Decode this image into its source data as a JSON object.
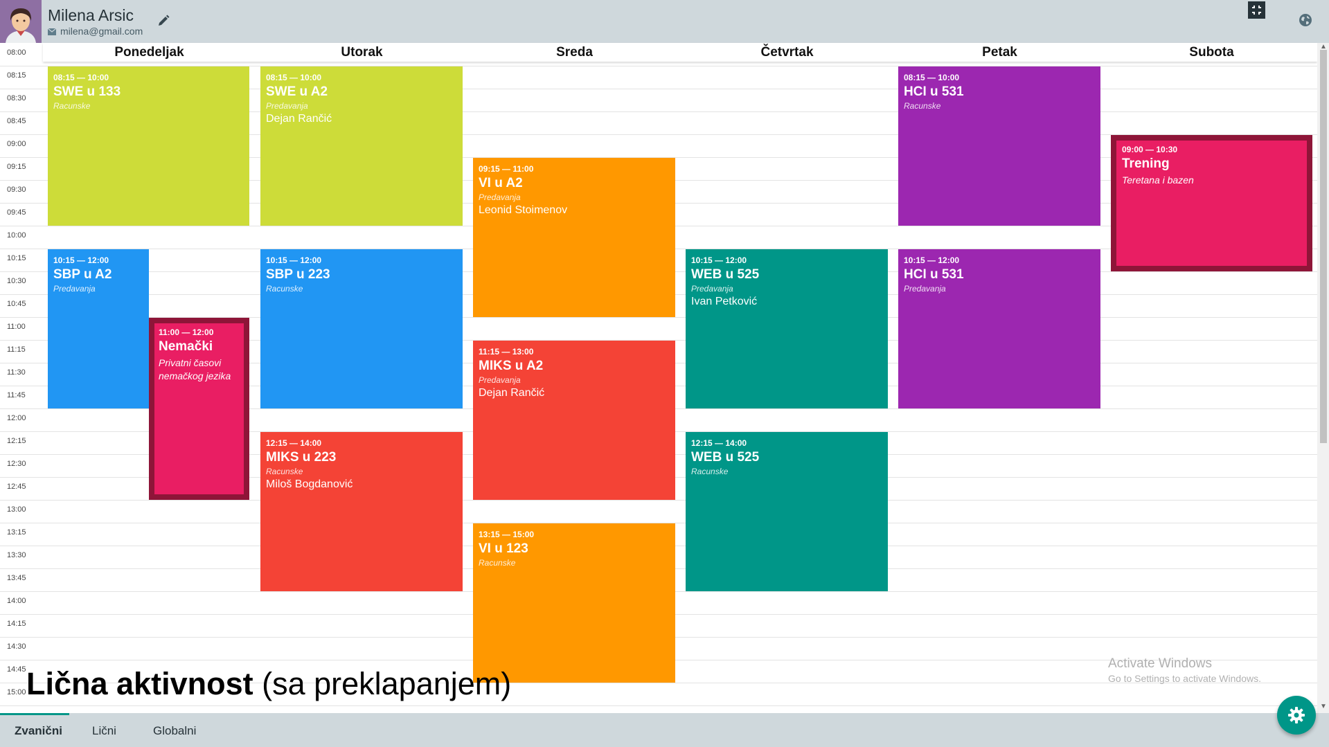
{
  "user": {
    "name": "Milena Arsic",
    "email": "milena@gmail.com"
  },
  "days": [
    "Ponedeljak",
    "Utorak",
    "Sreda",
    "Četvrtak",
    "Petak",
    "Subota"
  ],
  "times": [
    "08:00",
    "08:15",
    "08:30",
    "08:45",
    "09:00",
    "09:15",
    "09:30",
    "09:45",
    "10:00",
    "10:15",
    "10:30",
    "10:45",
    "11:00",
    "11:15",
    "11:30",
    "11:45",
    "12:00",
    "12:15",
    "12:30",
    "12:45",
    "13:00",
    "13:15",
    "13:30",
    "13:45",
    "14:00",
    "14:15",
    "14:30",
    "14:45",
    "15:00"
  ],
  "events": {
    "mon_swe": {
      "time": "08:15 — 10:00",
      "title": "SWE u 133",
      "type": "Racunske"
    },
    "mon_sbp": {
      "time": "10:15 — 12:00",
      "title": "SBP u A2",
      "type": "Predavanja"
    },
    "mon_nemacki": {
      "time": "11:00 — 12:00",
      "title": "Nemački",
      "note": "Privatni časovi nemačkog jezika"
    },
    "tue_swe": {
      "time": "08:15 — 10:00",
      "title": "SWE u A2",
      "type": "Predavanja",
      "lecturer": "Dejan Rančić"
    },
    "tue_sbp": {
      "time": "10:15 — 12:00",
      "title": "SBP u 223",
      "type": "Racunske"
    },
    "tue_miks": {
      "time": "12:15 — 14:00",
      "title": "MIKS u 223",
      "type": "Racunske",
      "lecturer": "Miloš Bogdanović"
    },
    "wed_vi": {
      "time": "09:15 — 11:00",
      "title": "VI u A2",
      "type": "Predavanja",
      "lecturer": "Leonid Stoimenov"
    },
    "wed_miks": {
      "time": "11:15 — 13:00",
      "title": "MIKS u A2",
      "type": "Predavanja",
      "lecturer": "Dejan Rančić"
    },
    "wed_vi123": {
      "time": "13:15 — 15:00",
      "title": "VI u 123",
      "type": "Racunske"
    },
    "thu_web1": {
      "time": "10:15 — 12:00",
      "title": "WEB u 525",
      "type": "Predavanja",
      "lecturer": "Ivan Petković"
    },
    "thu_web2": {
      "time": "12:15 — 14:00",
      "title": "WEB u 525",
      "type": "Racunske"
    },
    "fri_hci1": {
      "time": "08:15 — 10:00",
      "title": "HCI u 531",
      "type": "Racunske"
    },
    "fri_hci2": {
      "time": "10:15 — 12:00",
      "title": "HCI u 531",
      "type": "Predavanja"
    },
    "sat_trening": {
      "time": "09:00 — 10:30",
      "title": "Trening",
      "note": "Teretana i bazen"
    }
  },
  "caption": {
    "bold": "Lična aktivnost",
    "rest": " (sa preklapanjem)"
  },
  "watermark": {
    "line1": "Activate Windows",
    "line2": "Go to Settings to activate Windows."
  },
  "tabs": [
    "Zvanični",
    "Lični",
    "Globalni"
  ],
  "colors": {
    "lime": "#cddc39",
    "blue": "#2196f3",
    "orange": "#ff9800",
    "red": "#f44336",
    "teal": "#009688",
    "purple": "#9c27b0",
    "pink": "#e91e63",
    "header": "#cfd8dc"
  },
  "icons": [
    "avatar",
    "mail-icon",
    "edit-icon",
    "fullscreen-exit-icon",
    "globe-icon",
    "gear-icon"
  ]
}
